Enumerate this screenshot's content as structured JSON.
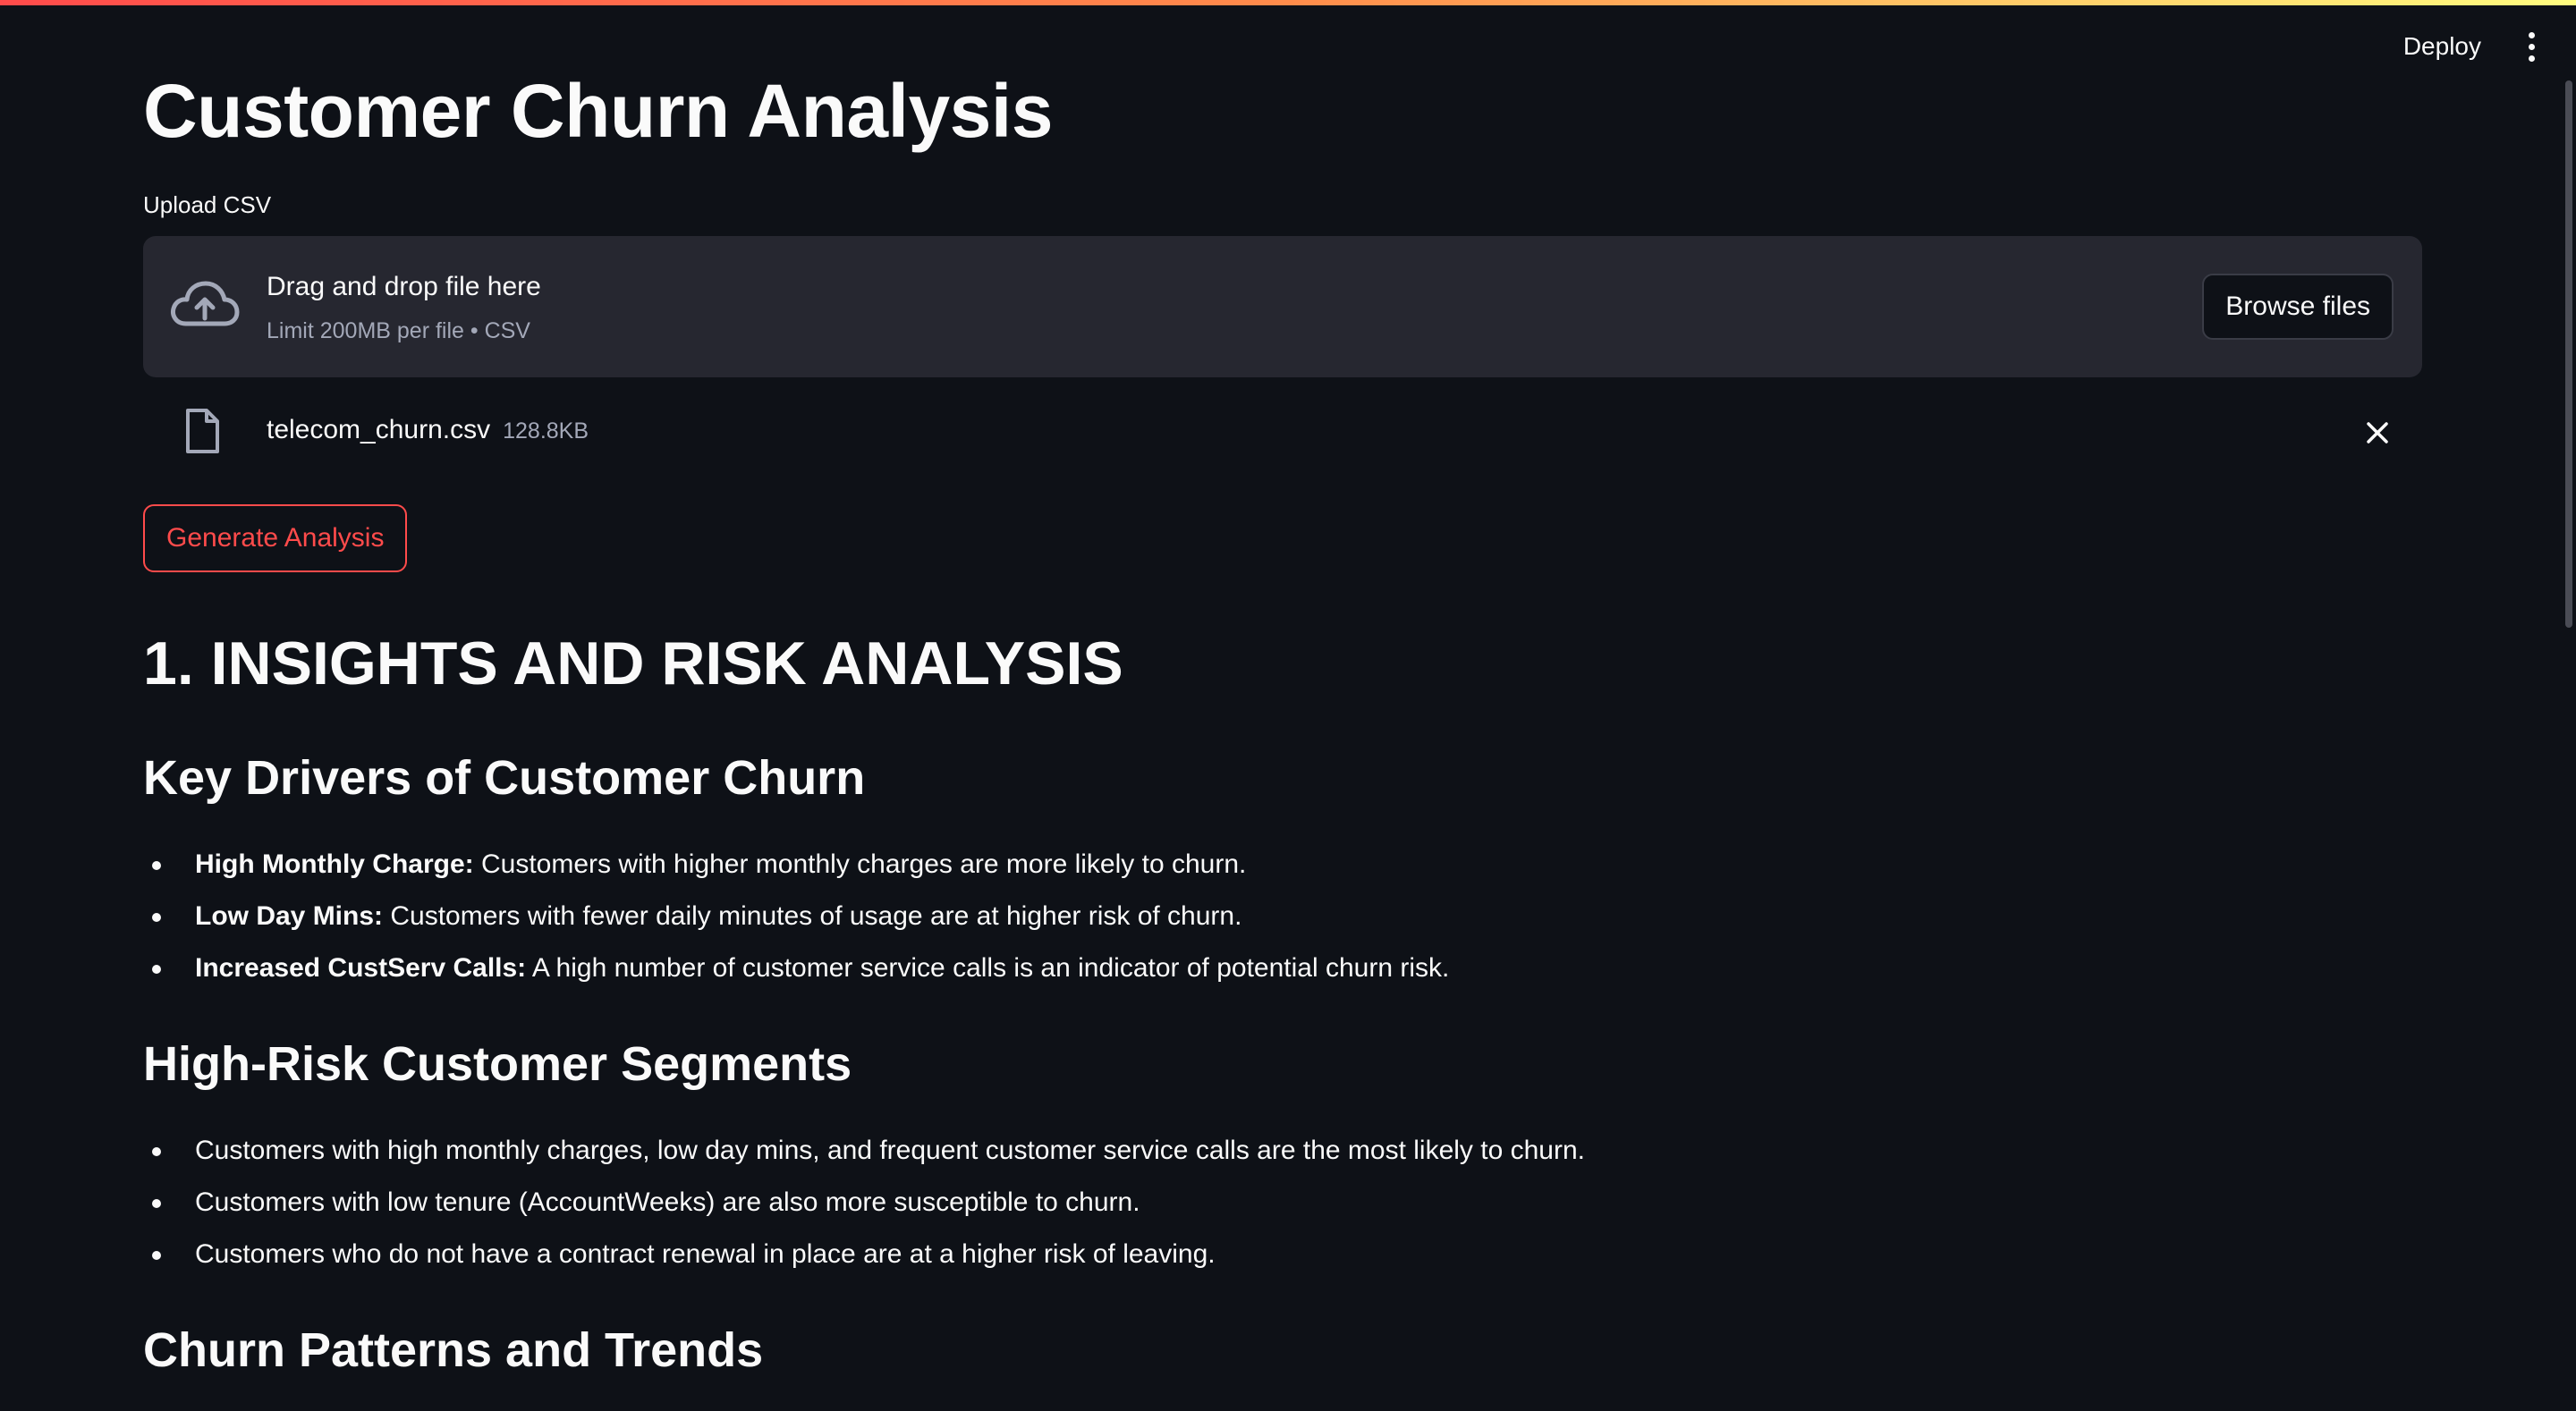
{
  "header": {
    "deploy_label": "Deploy",
    "menu_icon": "kebab-menu-icon"
  },
  "page": {
    "title": "Customer Churn Analysis"
  },
  "uploader": {
    "label": "Upload CSV",
    "drop_text": "Drag and drop file here",
    "limit_text": "Limit 200MB per file • CSV",
    "browse_label": "Browse files",
    "icon": "cloud-upload-icon"
  },
  "uploaded_file": {
    "name": "telecom_churn.csv",
    "size": "128.8KB",
    "icon": "file-icon",
    "remove_icon": "close-icon"
  },
  "actions": {
    "generate_label": "Generate Analysis"
  },
  "report": {
    "section_title": "1. INSIGHTS AND RISK ANALYSIS",
    "key_drivers": {
      "heading": "Key Drivers of Customer Churn",
      "items": [
        {
          "term": "High Monthly Charge:",
          "text": " Customers with higher monthly charges are more likely to churn."
        },
        {
          "term": "Low Day Mins:",
          "text": " Customers with fewer daily minutes of usage are at higher risk of churn."
        },
        {
          "term": "Increased CustServ Calls:",
          "text": " A high number of customer service calls is an indicator of potential churn risk."
        }
      ]
    },
    "high_risk": {
      "heading": "High-Risk Customer Segments",
      "items": [
        "Customers with high monthly charges, low day mins, and frequent customer service calls are the most likely to churn.",
        "Customers with low tenure (AccountWeeks) are also more susceptible to churn.",
        "Customers who do not have a contract renewal in place are at a higher risk of leaving."
      ]
    },
    "patterns": {
      "heading": "Churn Patterns and Trends"
    }
  },
  "colors": {
    "background": "#0e1117",
    "surface": "#262730",
    "accent": "#ff4b4b",
    "muted_text": "#a3a8b8"
  }
}
